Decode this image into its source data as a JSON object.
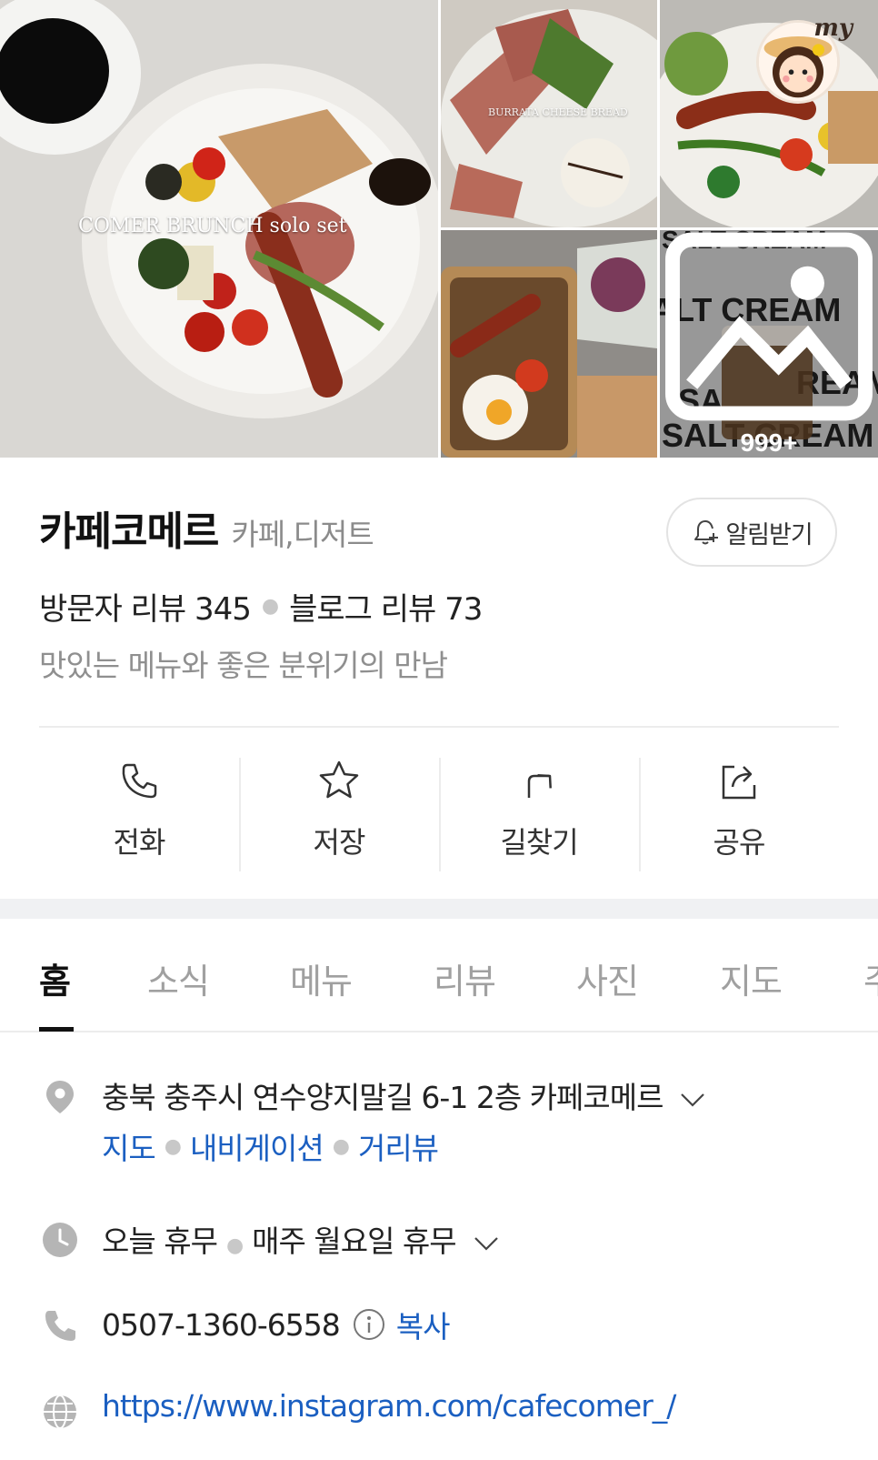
{
  "gallery": {
    "main_caption": "COMER BRUNCH solo set",
    "top_left_caption": "BURRATA CHEESE BREAD",
    "avatar_tag": "my",
    "more_count": "999+",
    "salt_cream_text": "SALT CREAM"
  },
  "place": {
    "name": "카페코메르",
    "category": "카페,디저트",
    "notify_label": "알림받기",
    "visitor_reviews": "방문자 리뷰 345",
    "blog_reviews": "블로그 리뷰 73",
    "tagline": "맛있는 메뉴와 좋은 분위기의 만남"
  },
  "actions": [
    {
      "label": "전화",
      "icon": "phone-icon"
    },
    {
      "label": "저장",
      "icon": "star-icon"
    },
    {
      "label": "길찾기",
      "icon": "directions-icon"
    },
    {
      "label": "공유",
      "icon": "share-icon"
    }
  ],
  "tabs": [
    {
      "label": "홈",
      "active": true
    },
    {
      "label": "소식",
      "active": false
    },
    {
      "label": "메뉴",
      "active": false
    },
    {
      "label": "리뷰",
      "active": false
    },
    {
      "label": "사진",
      "active": false
    },
    {
      "label": "지도",
      "active": false
    },
    {
      "label": "주",
      "active": false
    }
  ],
  "details": {
    "address": "충북 충주시 연수양지말길 6-1 2층 카페코메르",
    "address_links": [
      "지도",
      "내비게이션",
      "거리뷰"
    ],
    "hours": "오늘 휴무",
    "hours_note": "매주 월요일 휴무",
    "phone": "0507-1360-6558",
    "phone_copy": "복사",
    "website": "https://www.instagram.com/cafecomer_/"
  },
  "colors": {
    "link": "#1b5fc1",
    "icon_gray": "#b5b5b5",
    "divider": "#ececec"
  }
}
